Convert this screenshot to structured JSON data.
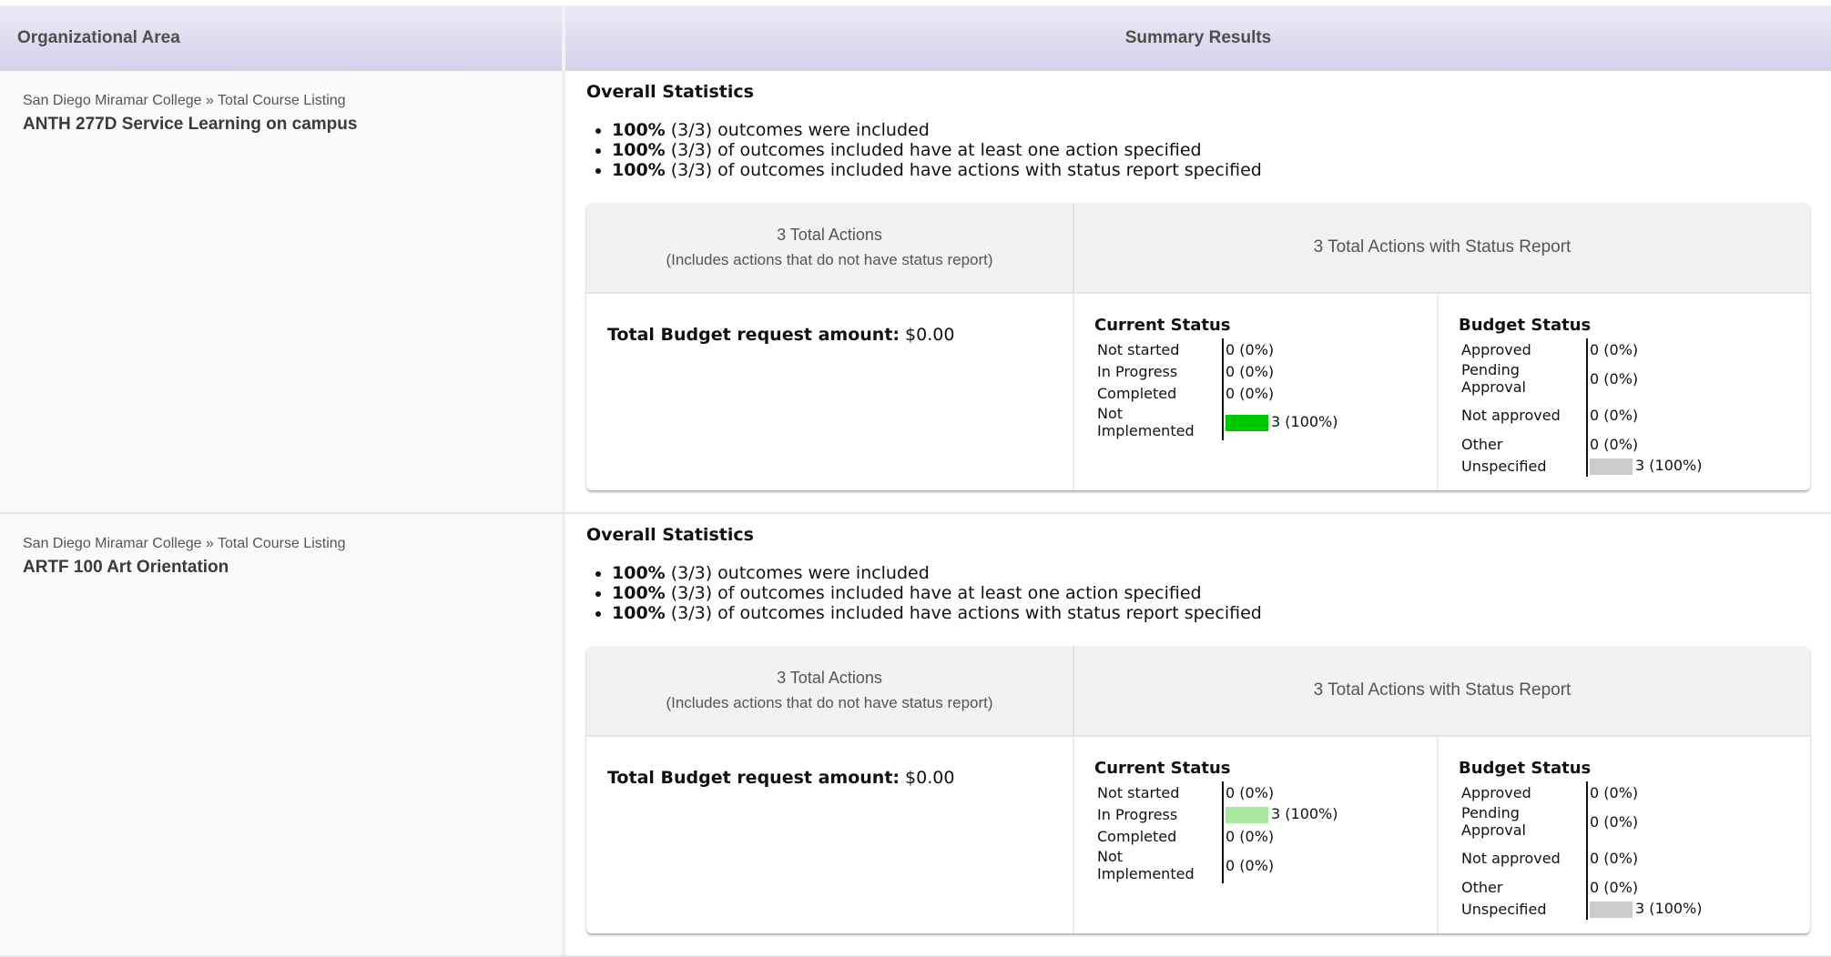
{
  "header": {
    "org_label": "Organizational Area",
    "summary_label": "Summary Results"
  },
  "rows": [
    {
      "breadcrumb": "San Diego Miramar College » Total Course Listing",
      "course": "ANTH 277D Service Learning on campus",
      "overall_title": "Overall Statistics",
      "stats": [
        {
          "pct": "100%",
          "text": " (3/3) outcomes were included"
        },
        {
          "pct": "100%",
          "text": " (3/3) of outcomes included have at least one action specified"
        },
        {
          "pct": "100%",
          "text": " (3/3) of outcomes included have actions with status report specified"
        }
      ],
      "total_actions": "3 Total Actions",
      "total_actions_note": "(Includes actions that do not have status report)",
      "actions_with_status": "3 Total Actions with Status Report",
      "budget_label": "Total Budget request amount:",
      "budget_value": " $0.00",
      "current_status_title": "Current Status",
      "current_status": [
        {
          "label": "Not started",
          "value": "0 (0%)",
          "fraction": 0
        },
        {
          "label": "In Progress",
          "value": "0 (0%)",
          "fraction": 0
        },
        {
          "label": "Completed",
          "value": "0 (0%)",
          "fraction": 0
        },
        {
          "label": "Not Implemented",
          "value": "3 (100%)",
          "fraction": 1,
          "color": "#00c800"
        }
      ],
      "budget_status_title": "Budget Status",
      "budget_status": [
        {
          "label": "Approved",
          "value": "0 (0%)",
          "fraction": 0
        },
        {
          "label": "Pending Approval",
          "value": "0 (0%)",
          "fraction": 0
        },
        {
          "label": "Not approved",
          "value": "0 (0%)",
          "fraction": 0
        },
        {
          "label": "Other",
          "value": "0 (0%)",
          "fraction": 0
        },
        {
          "label": "Unspecified",
          "value": "3 (100%)",
          "fraction": 1,
          "color": "#cccccc"
        }
      ]
    },
    {
      "breadcrumb": "San Diego Miramar College » Total Course Listing",
      "course": "ARTF 100 Art Orientation",
      "overall_title": "Overall Statistics",
      "stats": [
        {
          "pct": "100%",
          "text": " (3/3) outcomes were included"
        },
        {
          "pct": "100%",
          "text": " (3/3) of outcomes included have at least one action specified"
        },
        {
          "pct": "100%",
          "text": " (3/3) of outcomes included have actions with status report specified"
        }
      ],
      "total_actions": "3 Total Actions",
      "total_actions_note": "(Includes actions that do not have status report)",
      "actions_with_status": "3 Total Actions with Status Report",
      "budget_label": "Total Budget request amount:",
      "budget_value": " $0.00",
      "current_status_title": "Current Status",
      "current_status": [
        {
          "label": "Not started",
          "value": "0 (0%)",
          "fraction": 0
        },
        {
          "label": "In Progress",
          "value": "3 (100%)",
          "fraction": 1,
          "color": "#a8e8a0"
        },
        {
          "label": "Completed",
          "value": "0 (0%)",
          "fraction": 0
        },
        {
          "label": "Not Implemented",
          "value": "0 (0%)",
          "fraction": 0
        }
      ],
      "budget_status_title": "Budget Status",
      "budget_status": [
        {
          "label": "Approved",
          "value": "0 (0%)",
          "fraction": 0
        },
        {
          "label": "Pending Approval",
          "value": "0 (0%)",
          "fraction": 0
        },
        {
          "label": "Not approved",
          "value": "0 (0%)",
          "fraction": 0
        },
        {
          "label": "Other",
          "value": "0 (0%)",
          "fraction": 0
        },
        {
          "label": "Unspecified",
          "value": "3 (100%)",
          "fraction": 1,
          "color": "#cccccc"
        }
      ]
    }
  ]
}
